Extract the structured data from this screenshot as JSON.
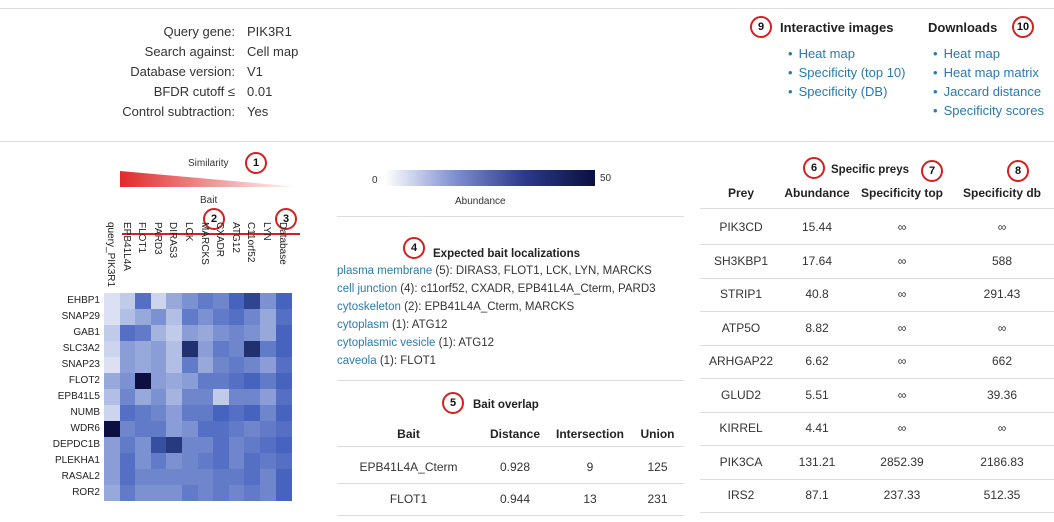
{
  "query": {
    "rows": [
      {
        "label": "Query gene:",
        "value": "PIK3R1"
      },
      {
        "label": "Search against:",
        "value": "Cell map"
      },
      {
        "label": "Database version:",
        "value": "V1"
      },
      {
        "label": "BFDR cutoff ≤",
        "value": "0.01"
      },
      {
        "label": "Control subtraction:",
        "value": "Yes"
      }
    ]
  },
  "interactive": {
    "title": "Interactive images",
    "links": [
      "Heat map",
      "Specificity (top 10)",
      "Specificity (DB)"
    ]
  },
  "downloads": {
    "title": "Downloads",
    "links": [
      "Heat map",
      "Heat map matrix",
      "Jaccard distance",
      "Specificity scores"
    ]
  },
  "badges": [
    "1",
    "2",
    "3",
    "4",
    "5",
    "6",
    "7",
    "8",
    "9",
    "10"
  ],
  "heatmap": {
    "similarity_label": "Similarity",
    "bait_label": "Bait",
    "database_label": "Database",
    "query_col": "query_PIK3R1",
    "columns": [
      "EPB41L4A",
      "FLOT1",
      "PARD3",
      "DIRAS3",
      "LCK",
      "MARCKS",
      "CXADR",
      "ATG12",
      "C11orf52",
      "LYN"
    ],
    "rows": [
      "EHBP1",
      "SNAP29",
      "GAB1",
      "SLC3A2",
      "SNAP23",
      "FLOT2",
      "EPB41L5",
      "NUMB",
      "WDR6",
      "DEPDC1B",
      "PLEKHA1",
      "RASAL2",
      "ROR2"
    ],
    "values": [
      [
        0.05,
        0.15,
        0.55,
        0.1,
        0.3,
        0.4,
        0.5,
        0.45,
        0.6,
        0.75,
        0.4,
        0.6
      ],
      [
        0.05,
        0.2,
        0.3,
        0.4,
        0.2,
        0.5,
        0.4,
        0.5,
        0.55,
        0.45,
        0.3,
        0.55
      ],
      [
        0.15,
        0.55,
        0.5,
        0.25,
        0.15,
        0.35,
        0.3,
        0.4,
        0.45,
        0.4,
        0.3,
        0.6
      ],
      [
        0.1,
        0.35,
        0.3,
        0.35,
        0.2,
        0.85,
        0.35,
        0.5,
        0.45,
        0.85,
        0.5,
        0.6
      ],
      [
        0.05,
        0.35,
        0.3,
        0.35,
        0.2,
        0.5,
        0.3,
        0.45,
        0.5,
        0.45,
        0.35,
        0.55
      ],
      [
        0.3,
        0.4,
        1.0,
        0.35,
        0.3,
        0.35,
        0.5,
        0.5,
        0.55,
        0.6,
        0.5,
        0.6
      ],
      [
        0.2,
        0.45,
        0.3,
        0.4,
        0.25,
        0.45,
        0.45,
        0.15,
        0.45,
        0.45,
        0.35,
        0.55
      ],
      [
        0.1,
        0.55,
        0.5,
        0.45,
        0.35,
        0.5,
        0.5,
        0.6,
        0.55,
        0.6,
        0.45,
        0.6
      ],
      [
        1.0,
        0.45,
        0.5,
        0.5,
        0.35,
        0.4,
        0.55,
        0.55,
        0.5,
        0.45,
        0.5,
        0.55
      ],
      [
        0.35,
        0.5,
        0.4,
        0.7,
        0.8,
        0.45,
        0.45,
        0.55,
        0.45,
        0.5,
        0.55,
        0.6
      ],
      [
        0.35,
        0.55,
        0.4,
        0.5,
        0.4,
        0.45,
        0.5,
        0.55,
        0.45,
        0.55,
        0.5,
        0.55
      ],
      [
        0.35,
        0.55,
        0.45,
        0.45,
        0.45,
        0.45,
        0.45,
        0.5,
        0.5,
        0.55,
        0.45,
        0.6
      ],
      [
        0.3,
        0.5,
        0.4,
        0.4,
        0.4,
        0.5,
        0.45,
        0.5,
        0.45,
        0.5,
        0.45,
        0.6
      ]
    ]
  },
  "abundance_scale": {
    "min": "0",
    "max": "50",
    "label": "Abundance"
  },
  "localizations": {
    "title": "Expected bait localizations",
    "items": [
      {
        "term": "plasma membrane",
        "rest": " (5): DIRAS3, FLOT1, LCK, LYN, MARCKS"
      },
      {
        "term": "cell junction",
        "rest": " (4): c11orf52, CXADR, EPB41L4A_Cterm, PARD3"
      },
      {
        "term": "cytoskeleton",
        "rest": " (2): EPB41L4A_Cterm, MARCKS"
      },
      {
        "term": "cytoplasm",
        "rest": " (1): ATG12"
      },
      {
        "term": "cytoplasmic vesicle",
        "rest": " (1): ATG12"
      },
      {
        "term": "caveola",
        "rest": " (1): FLOT1"
      }
    ]
  },
  "overlap": {
    "title": "Bait overlap",
    "headers": [
      "Bait",
      "Distance",
      "Intersection",
      "Union"
    ],
    "rows": [
      [
        "EPB41L4A_Cterm",
        "0.928",
        "9",
        "125"
      ],
      [
        "FLOT1",
        "0.944",
        "13",
        "231"
      ]
    ]
  },
  "preys": {
    "title": "Specific preys",
    "headers": [
      "Prey",
      "Abundance",
      "Specificity top",
      "Specificity db"
    ],
    "rows": [
      [
        "PIK3CD",
        "15.44",
        "∞",
        "∞"
      ],
      [
        "SH3KBP1",
        "17.64",
        "∞",
        "588"
      ],
      [
        "STRIP1",
        "40.8",
        "∞",
        "291.43"
      ],
      [
        "ATP5O",
        "8.82",
        "∞",
        "∞"
      ],
      [
        "ARHGAP22",
        "6.62",
        "∞",
        "662"
      ],
      [
        "GLUD2",
        "5.51",
        "∞",
        "39.36"
      ],
      [
        "KIRREL",
        "4.41",
        "∞",
        "∞"
      ],
      [
        "PIK3CA",
        "131.21",
        "2852.39",
        "2186.83"
      ],
      [
        "IRS2",
        "87.1",
        "237.33",
        "512.35"
      ]
    ]
  },
  "colors": {
    "accent": "#2a7ab0",
    "badge": "#d62020",
    "heat_high": "#0b1040",
    "heat_low": "#e8ecf7",
    "similarity": "#e03030"
  }
}
